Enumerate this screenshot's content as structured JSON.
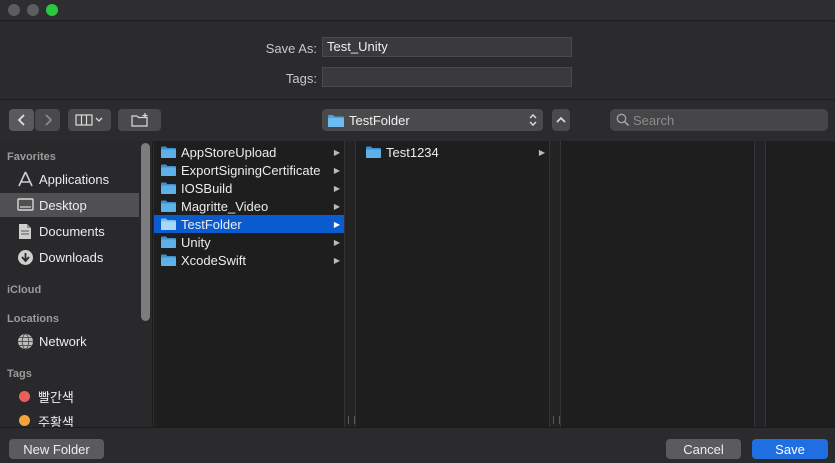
{
  "form": {
    "save_as_label": "Save As:",
    "save_as_value": "Test_Unity",
    "tags_label": "Tags:",
    "tags_value": ""
  },
  "toolbar": {
    "back_icon": "chevron-left",
    "forward_icon": "chevron-right",
    "view_icon": "columns-view",
    "new_folder_icon": "folder-plus",
    "location": "TestFolder",
    "search_placeholder": "Search"
  },
  "sidebar": {
    "favorites_header": "Favorites",
    "favorites": [
      {
        "label": "Applications",
        "icon": "applications-icon"
      },
      {
        "label": "Desktop",
        "icon": "desktop-icon",
        "selected": true
      },
      {
        "label": "Documents",
        "icon": "documents-icon"
      },
      {
        "label": "Downloads",
        "icon": "downloads-icon"
      }
    ],
    "icloud_header": "iCloud",
    "locations_header": "Locations",
    "locations": [
      {
        "label": "Network",
        "icon": "network-icon"
      }
    ],
    "tags_header": "Tags",
    "tags": [
      {
        "label": "빨간색",
        "color": "#ec5f59"
      },
      {
        "label": "주황색",
        "color": "#f3a33a"
      }
    ]
  },
  "columns": {
    "col1": [
      {
        "name": "AppStoreUpload"
      },
      {
        "name": "ExportSigningCertificate"
      },
      {
        "name": "IOSBuild"
      },
      {
        "name": "Magritte_Video"
      },
      {
        "name": "TestFolder",
        "selected": true
      },
      {
        "name": "Unity"
      },
      {
        "name": "XcodeSwift"
      }
    ],
    "col2": [
      {
        "name": "Test1234"
      }
    ]
  },
  "buttons": {
    "new_folder": "New Folder",
    "cancel": "Cancel",
    "save": "Save"
  },
  "colors": {
    "accent": "#0a5bd0",
    "save_button": "#1f6fe0",
    "folder": "#4aa3e0"
  }
}
